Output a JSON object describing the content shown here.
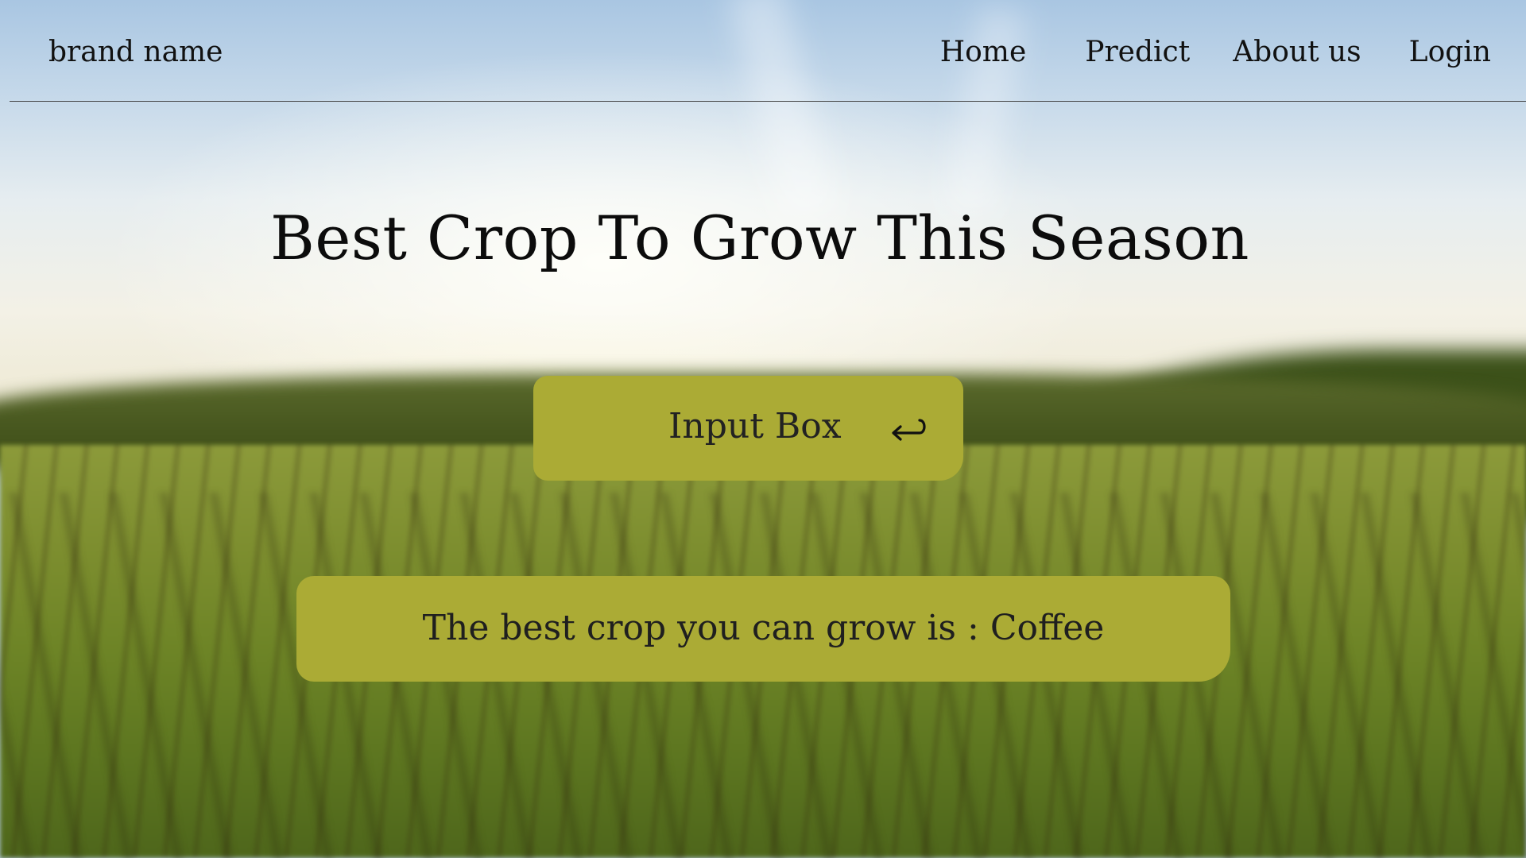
{
  "nav": {
    "brand": "brand name",
    "links": [
      "Home",
      "Predict",
      "About us",
      "Login"
    ]
  },
  "hero": {
    "title": "Best Crop To Grow This Season"
  },
  "input": {
    "label": "Input Box",
    "submit_icon": "enter-return-icon"
  },
  "result": {
    "text": "The best crop you can grow is : Coffee"
  },
  "colors": {
    "panel": "#abab35",
    "text": "#111111"
  }
}
